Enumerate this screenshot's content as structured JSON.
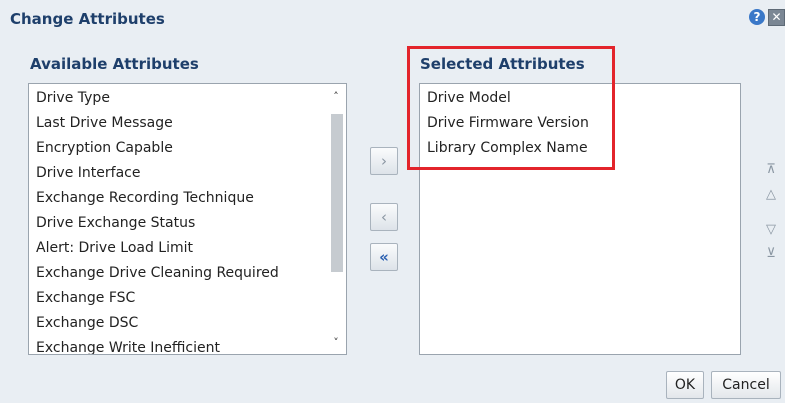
{
  "dialog": {
    "title": "Change Attributes",
    "help_symbol": "?",
    "close_symbol": "✕"
  },
  "available": {
    "label": "Available Attributes",
    "items": [
      "Drive Type",
      "Last Drive Message",
      "Encryption Capable",
      "Drive Interface",
      "Exchange Recording Technique",
      "Drive Exchange Status",
      "Alert: Drive Load Limit",
      "Exchange Drive Cleaning Required",
      "Exchange FSC",
      "Exchange DSC",
      "Exchange Write Inefficient"
    ]
  },
  "selected": {
    "label": "Selected Attributes",
    "items": [
      "Drive Model",
      "Drive Firmware Version",
      "Library Complex Name"
    ]
  },
  "shuttle": {
    "move_symbol": "›",
    "remove_symbol": "‹",
    "remove_all_symbol": "«"
  },
  "reorder": {
    "top_symbol": "⊼",
    "up_symbol": "△",
    "down_symbol": "▽",
    "bottom_symbol": "⊻"
  },
  "buttons": {
    "ok": "OK",
    "cancel": "Cancel"
  },
  "colors": {
    "title": "#1e3f6b",
    "highlight": "#e3242b",
    "active_arrow": "#2a5fb0"
  }
}
